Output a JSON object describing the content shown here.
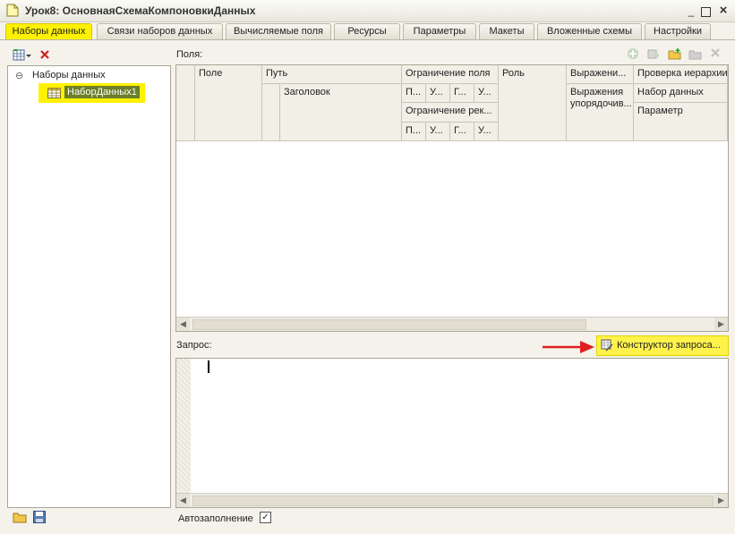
{
  "window": {
    "title": "Урок8: ОсновнаяСхемаКомпоновкиДанных",
    "minimize": "_",
    "maximize": "□",
    "close": "×"
  },
  "tabs": [
    {
      "label": "Наборы данных"
    },
    {
      "label": "Связи наборов данных"
    },
    {
      "label": "Вычисляемые поля"
    },
    {
      "label": "Ресурсы"
    },
    {
      "label": "Параметры"
    },
    {
      "label": "Макеты"
    },
    {
      "label": "Вложенные схемы"
    },
    {
      "label": "Настройки"
    }
  ],
  "tree": {
    "root": "Наборы данных",
    "item": "НаборДанных1",
    "collapse_glyph": "⊖"
  },
  "fields": {
    "label": "Поля:",
    "columns": {
      "pole": "Поле",
      "put": "Путь",
      "zagolovok": "Заголовок",
      "ogr_polya": "Ограничение поля",
      "ogr_rek": "Ограничение рек...",
      "sub": [
        "П...",
        "У...",
        "Г...",
        "У..."
      ],
      "rol": "Роль",
      "vyr": "Выражени...",
      "vyr_upor": "Выражения упорядочив...",
      "prov": "Проверка иерархии",
      "nabor": "Набор данных",
      "param": "Параметр"
    }
  },
  "query": {
    "label": "Запрос:",
    "constructor_button": "Конструктор запроса...",
    "text": ""
  },
  "autofill": {
    "label": "Автозаполнение",
    "checked": true,
    "check_glyph": "✓"
  },
  "colors": {
    "highlight": "#fff200",
    "arrow": "#e02020"
  }
}
